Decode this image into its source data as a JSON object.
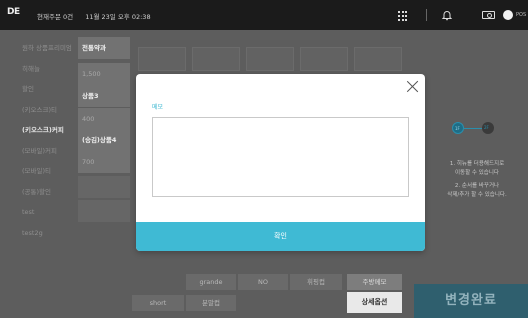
{
  "topbar": {
    "logo": "DE",
    "status_text": "현재주문 0건",
    "datetime": "11월 23일 오후 02:38",
    "user_label": "POS"
  },
  "sidebar": {
    "items": [
      {
        "label": "원하 상품프리미엄",
        "active": false
      },
      {
        "label": "히해늘",
        "active": false
      },
      {
        "label": "할인",
        "active": false
      },
      {
        "label": "(키오스크)티",
        "active": false
      },
      {
        "label": "(키오스크)커피",
        "active": true
      },
      {
        "label": "(모바일)커피",
        "active": false
      },
      {
        "label": "(모바일)티",
        "active": false
      },
      {
        "label": "(공통)할인",
        "active": false
      },
      {
        "label": "test",
        "active": false
      },
      {
        "label": "test2g",
        "active": false
      }
    ]
  },
  "product_cells": [
    {
      "label": "전통약과",
      "style": "strong"
    },
    {
      "label": "1,500",
      "style": "dim"
    },
    {
      "label": "상품3",
      "style": "strong"
    },
    {
      "label": "400",
      "style": "dim"
    },
    {
      "label": "(승김)상품4",
      "style": "strong"
    },
    {
      "label": "700",
      "style": "dim"
    }
  ],
  "right_panel": {
    "hint1_line1": "1. 히뉴를 더용해드지로",
    "hint1_line2": "이동할 수 있습니다",
    "hint2_line1": "2. 순서를 바꾸거나",
    "hint2_line2": "삭제/추가 할 수 있습니다."
  },
  "options": {
    "row1": [
      "grande",
      "NO",
      "휘핑컵",
      "주방메모"
    ],
    "row2": [
      "short",
      "분말컵"
    ]
  },
  "detail_button": "상세옵션",
  "done_button": "변경완료",
  "modal": {
    "label": "메모",
    "input_value": "",
    "confirm_label": "확인"
  },
  "colors": {
    "accent": "#3fbad4",
    "topbar": "#1b1b1b",
    "overlay_bg": "#5d5d5d"
  }
}
